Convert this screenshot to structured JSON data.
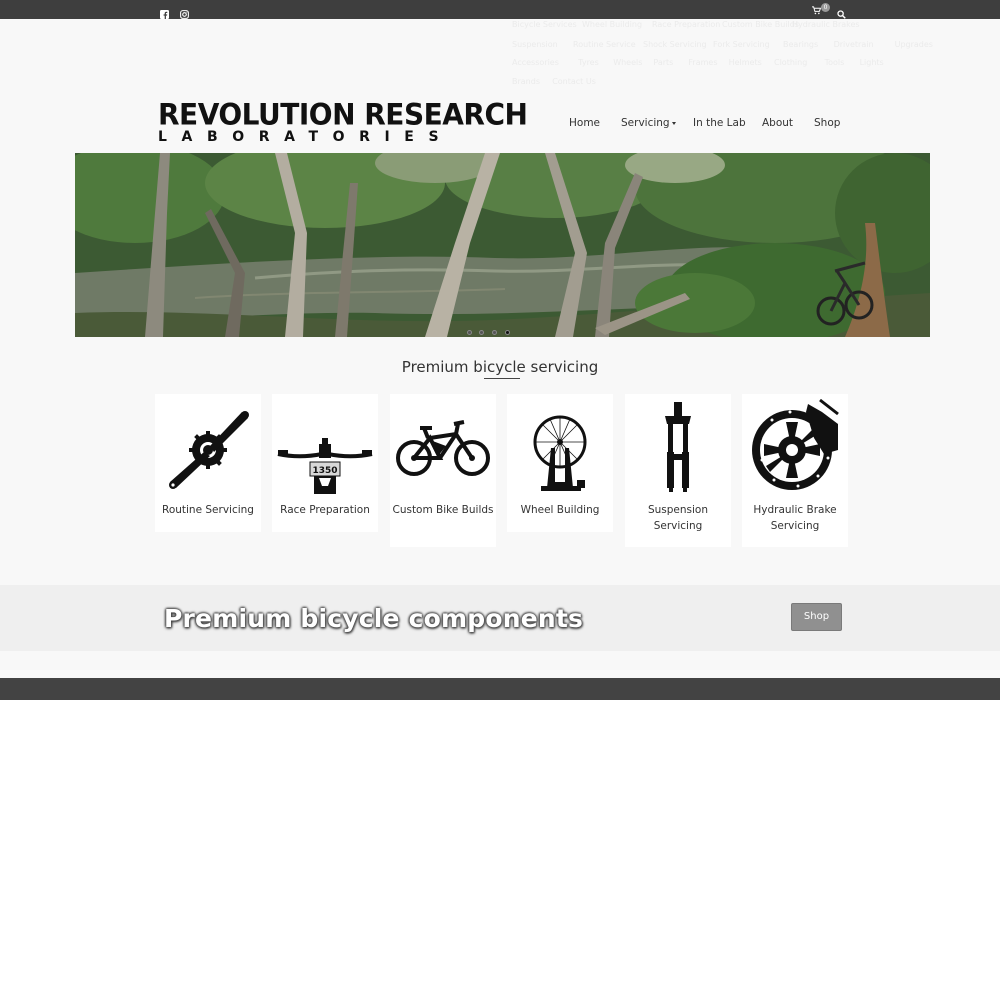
{
  "topbar": {
    "facebook_icon": "facebook-icon",
    "instagram_icon": "instagram-icon",
    "cart_icon": "cart-icon",
    "cart_count": "0",
    "search_icon": "search-icon"
  },
  "faint_menu": {
    "row1": [
      "Bicycle Services",
      "Wheel Building",
      "Race Preparation",
      "Custom Bike Builds",
      "Hydraulic Brakes"
    ],
    "row2": [
      "Suspension",
      "Routine Service",
      "Shock Servicing",
      "Fork Servicing",
      "Bearings",
      "Drivetrain",
      "Upgrades"
    ],
    "row3": [
      "Accessories",
      "Tyres",
      "Wheels",
      "Parts",
      "Frames",
      "Helmets",
      "Clothing",
      "Tools",
      "Lights"
    ],
    "row4": [
      "Brands",
      "Contact Us"
    ]
  },
  "logo": {
    "line1": "REVOLUTION RESEARCH",
    "line2": "LABORATORIES"
  },
  "nav": {
    "home": "Home",
    "servicing": "Servicing",
    "lab": "In the Lab",
    "about": "About",
    "shop": "Shop"
  },
  "hero": {
    "slide_count": 4,
    "active_slide": 4
  },
  "section": {
    "title": "Premium bicycle servicing"
  },
  "services": [
    {
      "label": "Routine Servicing",
      "icon": "crankset-icon"
    },
    {
      "label": "Race Preparation",
      "icon": "handlebar-number-plate-icon"
    },
    {
      "label": "Custom Bike Builds",
      "icon": "mountain-bike-icon"
    },
    {
      "label": "Wheel Building",
      "icon": "truing-stand-wheel-icon"
    },
    {
      "label": "Suspension Servicing",
      "icon": "suspension-fork-icon"
    },
    {
      "label": "Hydraulic Brake Servicing",
      "icon": "brake-rotor-caliper-icon"
    }
  ],
  "race_plate_number": "1350",
  "components": {
    "title": "Premium bicycle components",
    "button": "Shop"
  },
  "colors": {
    "topbar": "#3e3e3e",
    "page_bg": "#f8f8f8",
    "button": "#909090",
    "footer": "#434343"
  }
}
